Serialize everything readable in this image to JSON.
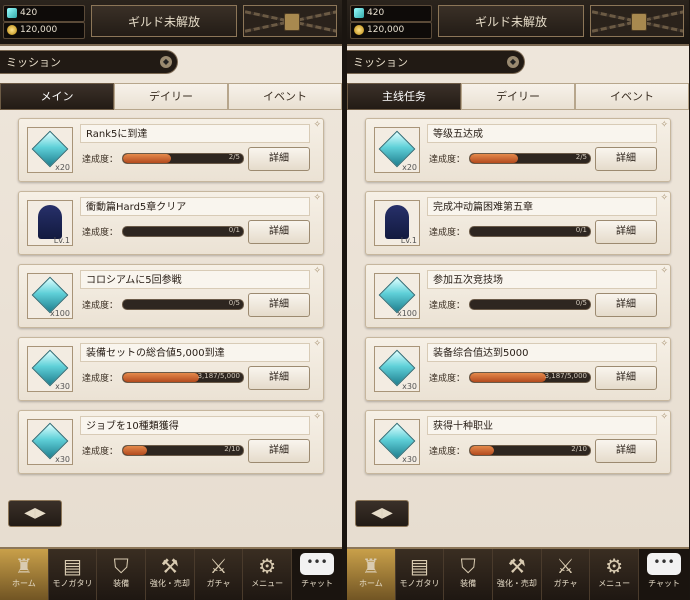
{
  "panels": [
    {
      "crystals": "420",
      "gold": "120,000",
      "guild": "ギルド未解放",
      "title": "ミッション",
      "tabs": [
        "メイン",
        "デイリー",
        "イベント"
      ],
      "progress_label": "達成度：",
      "detail_label": "詳細",
      "missions": [
        {
          "name": "Rank5に到達",
          "progress": "2/5",
          "ratio": 0.4,
          "reward_count": "x20",
          "reward_icon": "crystal-icon"
        },
        {
          "name": "衝動篇Hard5章クリア",
          "progress": "0/1",
          "ratio": 0,
          "reward_count": "Lv.1",
          "reward_icon": "character-icon"
        },
        {
          "name": "コロシアムに5回参戦",
          "progress": "0/5",
          "ratio": 0,
          "reward_count": "x100",
          "reward_icon": "crystal-icon"
        },
        {
          "name": "装備セットの総合値5,000到達",
          "progress": "3,187/5,000",
          "ratio": 0.637,
          "reward_count": "x30",
          "reward_icon": "crystal-icon"
        },
        {
          "name": "ジョブを10種類獲得",
          "progress": "2/10",
          "ratio": 0.2,
          "reward_count": "x30",
          "reward_icon": "crystal-icon"
        }
      ],
      "nav": [
        "ホーム",
        "モノガタリ",
        "装備",
        "強化・売却",
        "ガチャ",
        "メニュー"
      ],
      "chat": "チャット"
    },
    {
      "crystals": "420",
      "gold": "120,000",
      "guild": "ギルド未解放",
      "title": "ミッション",
      "tabs": [
        "主线任务",
        "デイリー",
        "イベント"
      ],
      "progress_label": "達成度：",
      "detail_label": "詳細",
      "missions": [
        {
          "name": "等级五达成",
          "progress": "2/5",
          "ratio": 0.4,
          "reward_count": "x20",
          "reward_icon": "crystal-icon"
        },
        {
          "name": "完成冲动篇困难第五章",
          "progress": "0/1",
          "ratio": 0,
          "reward_count": "Lv.1",
          "reward_icon": "character-icon"
        },
        {
          "name": "参加五次竞技场",
          "progress": "0/5",
          "ratio": 0,
          "reward_count": "x100",
          "reward_icon": "crystal-icon"
        },
        {
          "name": "装备综合值达到5000",
          "progress": "3,187/5,000",
          "ratio": 0.637,
          "reward_count": "x30",
          "reward_icon": "crystal-icon"
        },
        {
          "name": "获得十种职业",
          "progress": "2/10",
          "ratio": 0.2,
          "reward_count": "x30",
          "reward_icon": "crystal-icon"
        }
      ],
      "nav": [
        "ホーム",
        "モノガタリ",
        "装備",
        "強化・売却",
        "ガチャ",
        "メニュー"
      ],
      "chat": "チャット"
    }
  ]
}
